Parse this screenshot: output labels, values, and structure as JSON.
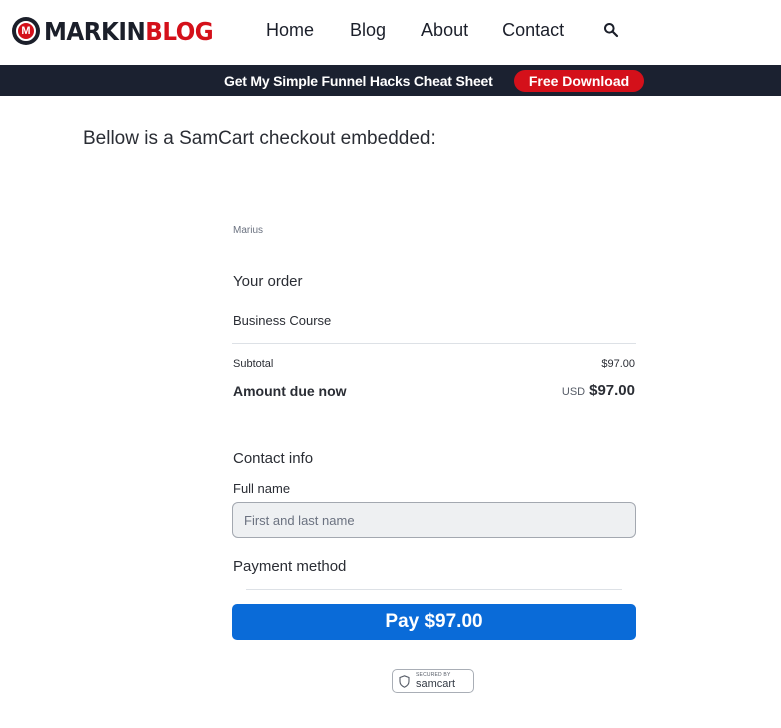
{
  "header": {
    "logo": {
      "part1": "MARKIN",
      "part2": "BLOG",
      "mark_letter": "M"
    },
    "nav": [
      "Home",
      "Blog",
      "About",
      "Contact"
    ],
    "search_icon": "search-icon"
  },
  "promo": {
    "text": "Get My Simple Funnel Hacks Cheat Sheet",
    "button": "Free Download",
    "background_color": "#1b2130",
    "button_color": "#d4101a"
  },
  "intro": "Bellow is a SamCart checkout embedded:",
  "checkout": {
    "store_name": "Marius",
    "order_title": "Your order",
    "product": "Business Course",
    "subtotal_label": "Subtotal",
    "subtotal_value": "$97.00",
    "due_label": "Amount due now",
    "due_currency": "USD",
    "due_amount": "$97.00",
    "contact_title": "Contact info",
    "full_name_label": "Full name",
    "full_name_placeholder": "First and last name",
    "full_name_value": "",
    "payment_title": "Payment method",
    "pay_button": "Pay $97.00",
    "pay_button_color": "#0a6bd8",
    "secured_small": "SECURED BY",
    "secured_brand": "samcart"
  }
}
